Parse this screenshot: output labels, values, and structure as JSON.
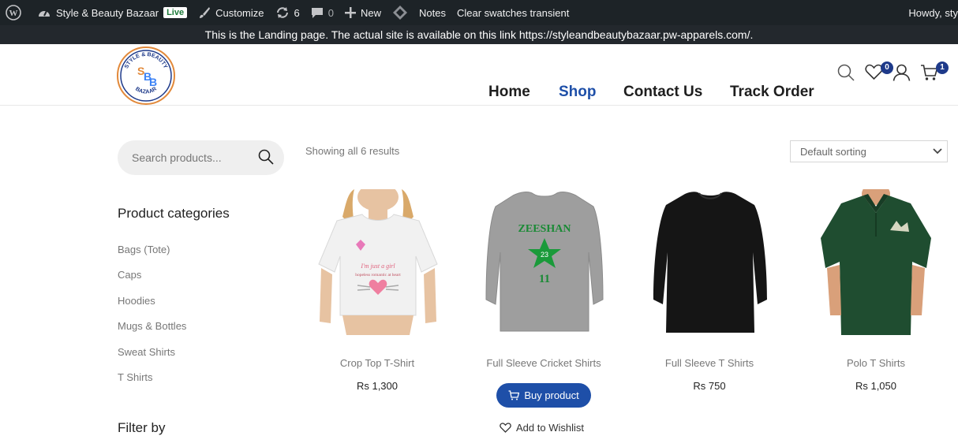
{
  "adminbar": {
    "site_name": "Style & Beauty Bazaar",
    "live_badge": "Live",
    "customize": "Customize",
    "updates_count": "6",
    "comments_count": "0",
    "new": "New",
    "notes": "Notes",
    "clear_swatches": "Clear swatches transient",
    "howdy": "Howdy, sty"
  },
  "notice": "This is the Landing page. The actual site is available on this link https://styleandbeautybazaar.pw-apparels.com/.",
  "header": {
    "logo_text_top": "STYLE & BEAUTY",
    "logo_text_bottom": "BAZAAR",
    "logo_letters": "SBB",
    "nav": [
      "Home",
      "Shop",
      "Contact Us",
      "Track Order"
    ],
    "active_nav": "Shop",
    "wishlist_count": "0",
    "cart_count": "1"
  },
  "sidebar": {
    "search_placeholder": "Search products...",
    "categories_title": "Product categories",
    "categories": [
      "Bags (Tote)",
      "Caps",
      "Hoodies",
      "Mugs & Bottles",
      "Sweat Shirts",
      "T Shirts"
    ],
    "filter_title": "Filter by"
  },
  "shop": {
    "results_text": "Showing all 6 results",
    "sorting": "Default sorting",
    "products": [
      {
        "name": "Crop Top T-Shirt",
        "price": "Rs 1,300",
        "shirt_text": "I'm just a girl",
        "shirt_sub": "hopeless romantic at heart"
      },
      {
        "name": "Full Sleeve Cricket Shirts",
        "price": "",
        "shirt_text": "ZEESHAN",
        "shirt_sub": "11",
        "star_text": "23"
      },
      {
        "name": "Full Sleeve T Shirts",
        "price": "Rs 750"
      },
      {
        "name": "Polo T Shirts",
        "price": "Rs 1,050"
      }
    ],
    "buy_label": "Buy product",
    "wishlist_label": "Add to Wishlist"
  },
  "colors": {
    "accent": "#1e4fa8",
    "adminbar": "#1d2327",
    "polo_green": "#1f4d30",
    "cricket_green": "#1a9a3a"
  }
}
